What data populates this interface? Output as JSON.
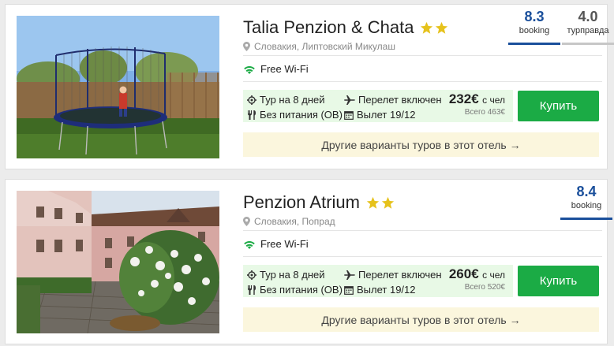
{
  "colors": {
    "accent_green": "#1bab45",
    "rating_blue": "#1a4f9b",
    "other_bg": "#fbf6dd",
    "tour_bg": "#e8f9e6",
    "star": "#e6c21c"
  },
  "hotels": [
    {
      "name": "Talia Penzion & Chata",
      "stars": 2,
      "location": "Словакия, Липтовский Микулаш",
      "amenity": "Free Wi-Fi",
      "duration": "Тур на 8 дней",
      "meals": "Без питания (OB)",
      "flight": "Перелет включен",
      "departure": "Вылет 19/12",
      "price": "232€",
      "price_unit": "с чел",
      "total": "Всего 463€",
      "buy_label": "Купить",
      "other_label": "Другие варианты туров в этот отель →",
      "ratings": [
        {
          "score": "8.3",
          "source": "booking"
        },
        {
          "score": "4.0",
          "source": "турправда"
        }
      ]
    },
    {
      "name": "Penzion Atrium",
      "stars": 2,
      "location": "Словакия, Попрад",
      "amenity": "Free Wi-Fi",
      "duration": "Тур на 8 дней",
      "meals": "Без питания (OB)",
      "flight": "Перелет включен",
      "departure": "Вылет 19/12",
      "price": "260€",
      "price_unit": "с чел",
      "total": "Всего 520€",
      "buy_label": "Купить",
      "other_label": "Другие варианты туров в этот отель →",
      "ratings": [
        {
          "score": "8.4",
          "source": "booking"
        }
      ]
    }
  ]
}
